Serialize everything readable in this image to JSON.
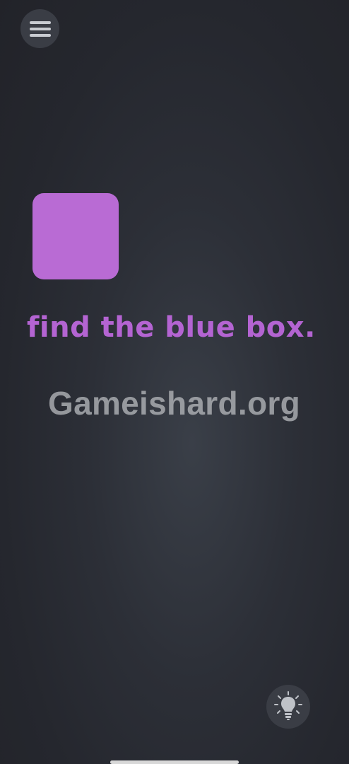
{
  "menu": {
    "icon": "hamburger-menu-icon"
  },
  "puzzle": {
    "box_color": "#b96bd4",
    "prompt": "find the blue box.",
    "prompt_color": "#b464d2"
  },
  "watermark": {
    "text": "Gameishard.org"
  },
  "hint": {
    "icon": "lightbulb-icon"
  }
}
